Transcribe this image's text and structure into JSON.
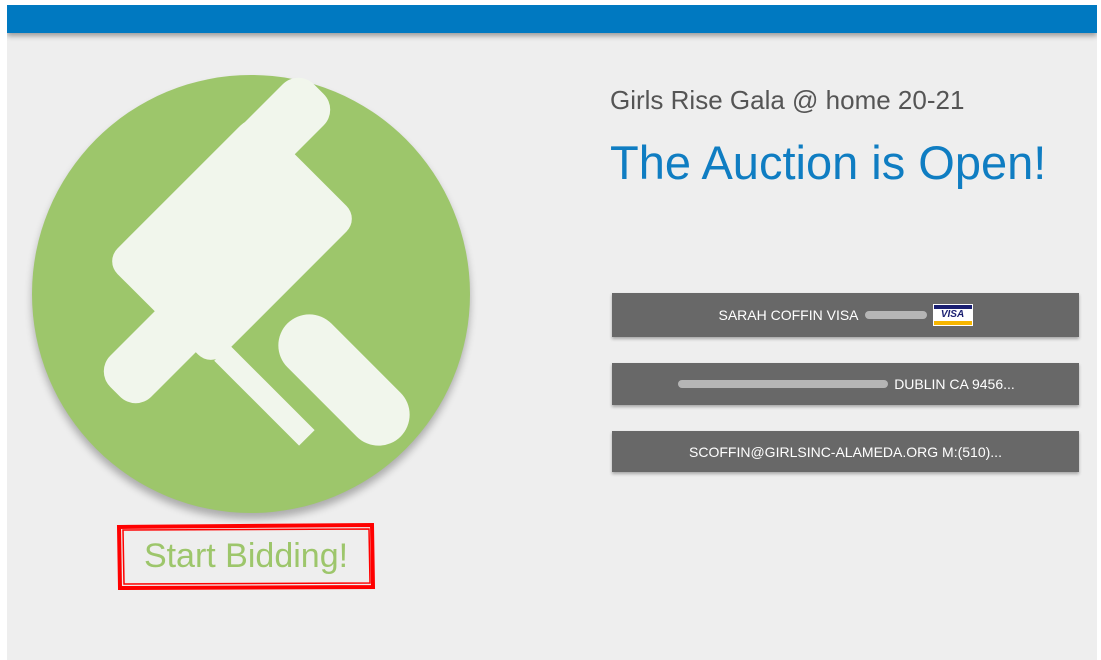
{
  "header": {
    "bar_color": "#0079c1"
  },
  "hero": {
    "icon": "gavel-icon",
    "circle_color": "#9dc66b",
    "start_bidding_label": "Start Bidding!",
    "highlight_color": "#ff0000"
  },
  "event": {
    "name": "Girls Rise Gala @ home 20-21",
    "status": "The Auction is Open!"
  },
  "account": {
    "card": {
      "name": "SARAH COFFIN VISA",
      "card_brand": "VISA",
      "card_icon": "visa-card-icon"
    },
    "address": {
      "visible_text": "DUBLIN CA 9456..."
    },
    "contact": {
      "text": "SCOFFIN@GIRLSINC-ALAMEDA.ORG M:(510)..."
    }
  }
}
